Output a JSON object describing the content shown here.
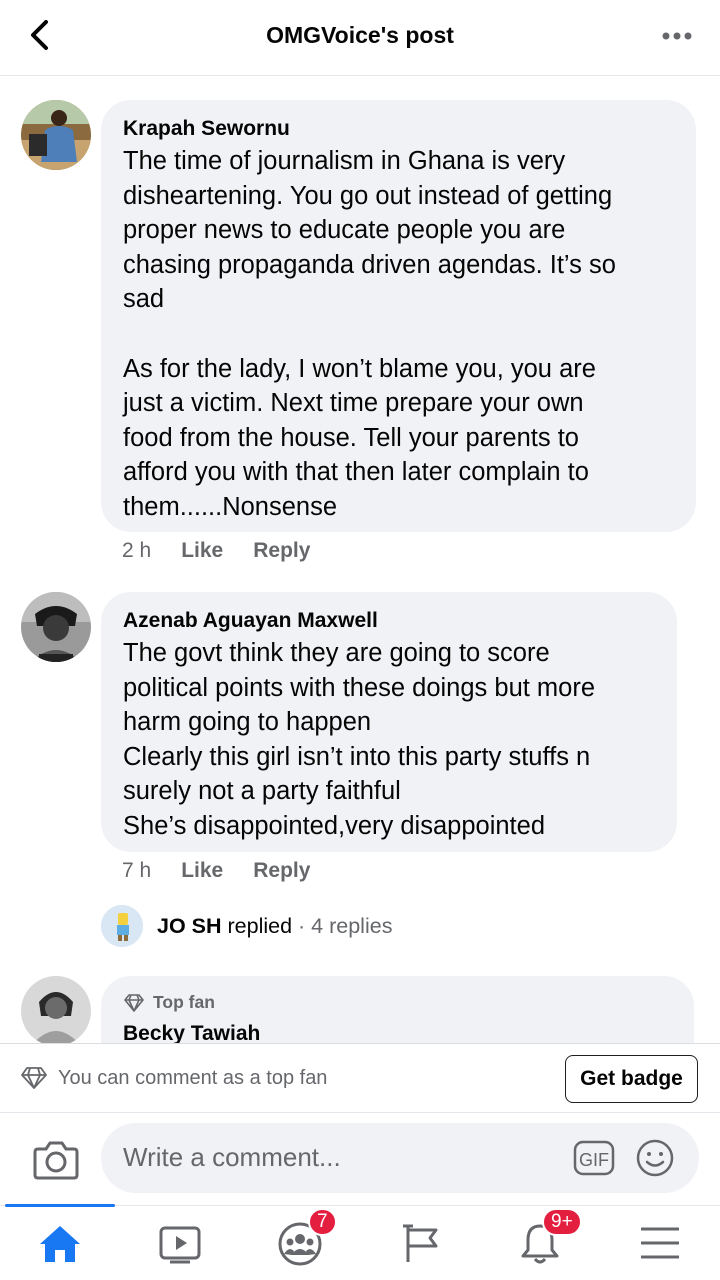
{
  "header": {
    "title": "OMGVoice's post"
  },
  "comments": [
    {
      "author": "Krapah Sewornu",
      "text": "The time of journalism in Ghana is very\ndisheartening. You go out instead of getting\nproper news to educate people you are\nchasing propaganda driven agendas. It’s so\nsad\n\nAs for the lady, I won’t blame you, you are\njust a victim. Next time prepare your own\nfood from the house. Tell your parents to\nafford you with that then later complain to\nthem......Nonsense",
      "time": "2 h",
      "like_label": "Like",
      "reply_label": "Reply"
    },
    {
      "author": "Azenab Aguayan Maxwell",
      "text": "The govt think they are going to score\npolitical points with these doings but more\nharm going to happen\nClearly this girl isn’t into this party stuffs n\nsurely not a party faithful\nShe’s disappointed,very disappointed",
      "time": "7 h",
      "like_label": "Like",
      "reply_label": "Reply",
      "replies_preview": {
        "name": "JO SH",
        "verb": "replied",
        "count": "· 4 replies"
      }
    },
    {
      "badge": "Top fan",
      "author": "Becky Tawiah"
    }
  ],
  "topfan_bar": {
    "message": "You can comment as a top fan",
    "button": "Get badge"
  },
  "composer": {
    "placeholder": "Write a comment...",
    "gif_label": "GIF"
  },
  "tabbar": {
    "tabs": [
      "home-icon",
      "watch-icon",
      "groups-icon",
      "pages-flag-icon",
      "notifications-icon",
      "menu-icon"
    ],
    "groups_badge": "7",
    "notifications_badge": "9+",
    "active_color": "#1877f2"
  }
}
